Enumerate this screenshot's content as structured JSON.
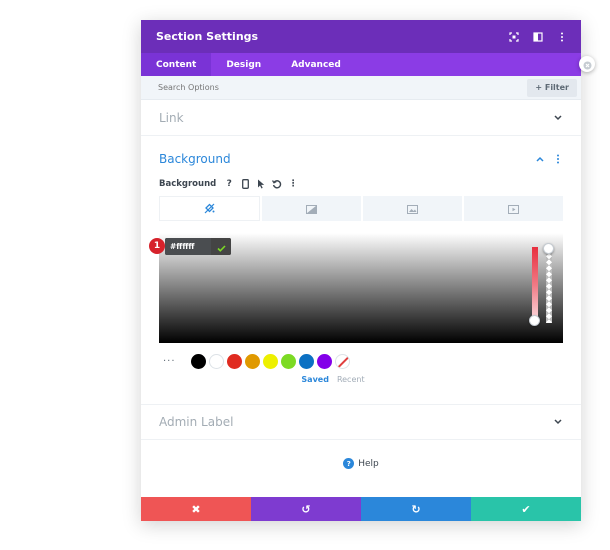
{
  "header": {
    "title": "Section Settings",
    "icons": [
      "expand-icon",
      "sidebar-icon",
      "more-vertical-icon"
    ],
    "color": "#6c2eb9"
  },
  "tabs": [
    {
      "label": "Content",
      "active": true
    },
    {
      "label": "Design",
      "active": false
    },
    {
      "label": "Advanced",
      "active": false
    }
  ],
  "search": {
    "placeholder": "Search Options",
    "filter_label": "+ Filter"
  },
  "sections": {
    "link": "Link",
    "background": "Background",
    "admin_label": "Admin Label"
  },
  "background": {
    "option_label": "Background",
    "option_icons": [
      "help-icon",
      "mobile-icon",
      "hover-pointer-icon",
      "reset-icon",
      "more-icon"
    ],
    "help_glyph": "?",
    "more_glyph": "⋮",
    "type_tabs": [
      "color-fill-icon",
      "gradient-icon",
      "image-icon",
      "video-icon"
    ],
    "hex_value": "#ffffff",
    "step_number": "1",
    "swatch_dots": "···",
    "swatches": [
      "#000000",
      "#ffffff",
      "#e02b20",
      "#e09900",
      "#edf000",
      "#7cda24",
      "#0c71c3",
      "#8300e9"
    ],
    "saved_label": "Saved",
    "recent_label": "Recent"
  },
  "help_label": "Help",
  "footer": {
    "cancel_glyph": "✖",
    "undo_glyph": "↺",
    "redo_glyph": "↻",
    "save_glyph": "✔",
    "colors": {
      "cancel": "#ef5555",
      "undo": "#7e3bd0",
      "redo": "#2b87da",
      "save": "#29c4a9"
    }
  }
}
